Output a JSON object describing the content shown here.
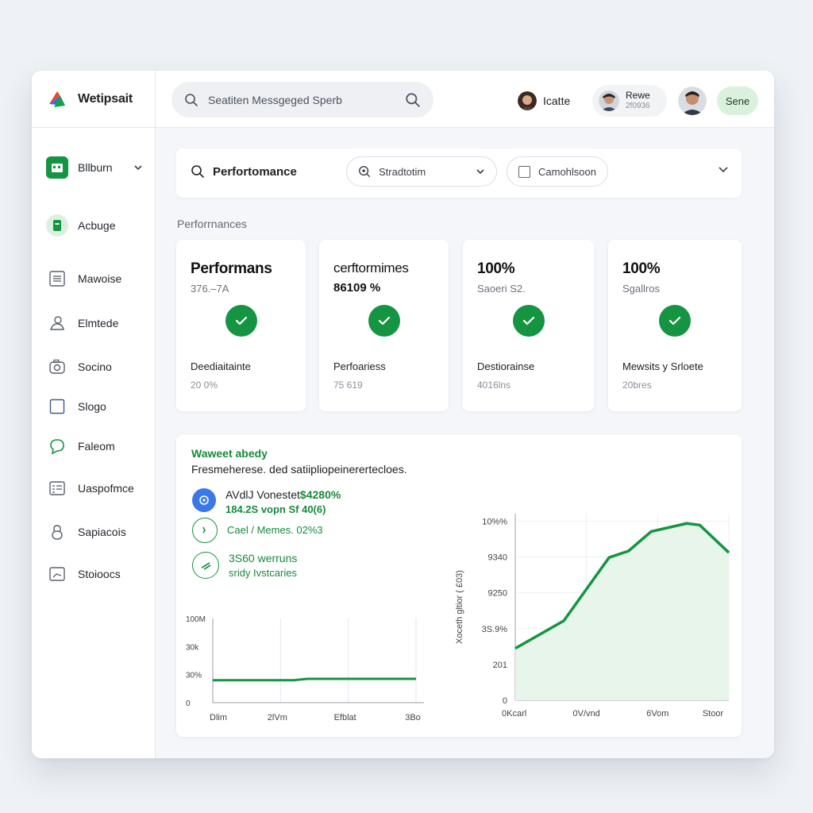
{
  "app": {
    "brand": "Wetipsait"
  },
  "search": {
    "placeholder": "Seatiten Messgeged Sperb"
  },
  "header": {
    "user1_name": "Icatte",
    "user2_name": "Rewe",
    "user2_sub": "2f0936",
    "send_label": "Sene"
  },
  "sidebar": {
    "items": [
      {
        "label": "Bllburn",
        "icon": "calendar-icon"
      },
      {
        "label": "Acbuge",
        "icon": "clipboard-icon"
      },
      {
        "label": "Mawoise",
        "icon": "document-icon"
      },
      {
        "label": "Elmtede",
        "icon": "user-icon"
      },
      {
        "label": "Socino",
        "icon": "camera-icon"
      },
      {
        "label": "Slogo",
        "icon": "square-icon"
      },
      {
        "label": "Faleom",
        "icon": "chat-icon"
      },
      {
        "label": "Uaspofmce",
        "icon": "list-icon"
      },
      {
        "label": "Sapiacois",
        "icon": "lock-icon"
      },
      {
        "label": "Stoioocs",
        "icon": "chart-icon"
      }
    ]
  },
  "filters": {
    "title": "Perfortomance",
    "select_label": "Stradtotim",
    "check_label": "Camohlsoon"
  },
  "section_label": "Perforrnances",
  "cards": [
    {
      "title": "Performans",
      "sub": "376.–7A",
      "footer": "Deediaitainte",
      "footer_sub": "20 0%"
    },
    {
      "title": "cerftormimes",
      "sub": "86109 %",
      "footer": "Perfoariess",
      "footer_sub": "75 619"
    },
    {
      "title": "100%",
      "sub": "Saoeri S2.",
      "footer": "Destiorainse",
      "footer_sub": "4016lns"
    },
    {
      "title": "100%",
      "sub": "Sgallros",
      "footer": "Mewsits y Srloete",
      "footer_sub": "20bres"
    }
  ],
  "panel": {
    "title": "Waweet abedy",
    "subtitle": "Fresmeherese. ded satiipliopeinerertecloes.",
    "metrics": [
      {
        "line1_prefix": "AVdlJ Vonestet",
        "line1_value": "$4280%",
        "line2": "184.2S vopn Sf 40(6)",
        "icon": "info-icon"
      },
      {
        "line1_prefix": "",
        "line1_value": "",
        "line2": "Cael / Memes. 02%3",
        "icon": "clock-icon"
      },
      {
        "line1_prefix": "",
        "line1_value": "3S60 werruns",
        "line2": "sridy Ivstcaries",
        "icon": "trend-icon"
      }
    ]
  },
  "colors": {
    "accent": "#159442",
    "accent_fill": "#e8f5ea",
    "text": "#202124"
  },
  "chart_data": [
    {
      "type": "line",
      "categories": [
        "Dlim",
        "2lVm",
        "Efblat",
        "3Bo"
      ],
      "y_tick_labels": [
        "0",
        "30%",
        "30k",
        "100M"
      ],
      "values": [
        0.8,
        0.8,
        0.85,
        0.85,
        0.85,
        0.85
      ],
      "x_positions": [
        0,
        1.2,
        1.4,
        2.0,
        2.6,
        3.0
      ],
      "ylim": [
        0,
        3
      ],
      "grid": true
    },
    {
      "type": "area",
      "categories": [
        "0Kcarl",
        "0V/vnd",
        "6Vom",
        "Stoor"
      ],
      "y_tick_labels": [
        "0",
        "201",
        "3S.9%",
        "9250",
        "9340",
        "10%%"
      ],
      "ylabel": "Xoceth gltior ( £03)",
      "x": [
        0,
        0.75,
        1.45,
        1.75,
        2.1,
        2.65,
        2.85,
        3.3
      ],
      "values": [
        1.6,
        2.45,
        4.4,
        4.6,
        5.2,
        5.45,
        5.4,
        4.55
      ],
      "ylim": [
        0,
        5.75
      ],
      "grid": true
    }
  ]
}
